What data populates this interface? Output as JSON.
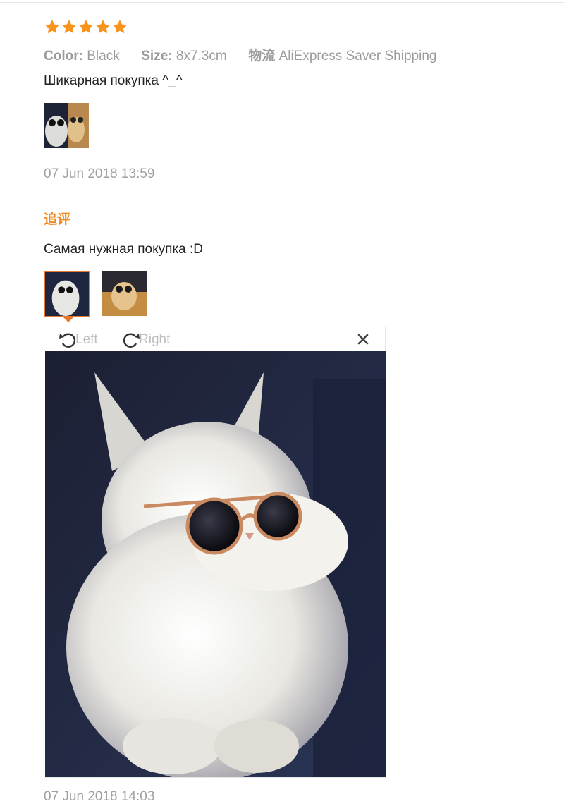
{
  "review1": {
    "stars": 5,
    "star_color": "#f7941d",
    "color_label": "Color:",
    "color_value": "Black",
    "size_label": "Size:",
    "size_value": "8x7.3cm",
    "shipping_label": "物流",
    "shipping_value": "AliExpress Saver Shipping",
    "text": "Шикарная покупка ^_^",
    "date": "07 Jun 2018 13:59"
  },
  "followup": {
    "heading": "追评",
    "heading_color": "#f08a24",
    "text": "Самая нужная покупка :D",
    "selected_thumb_border": "#e8772a",
    "viewer": {
      "rotate_left_label": "Left",
      "rotate_right_label": "Right",
      "rotate_left_icon": "rotate-left-icon",
      "rotate_right_icon": "rotate-right-icon",
      "close_icon": "close-icon"
    },
    "date": "07 Jun 2018 14:03"
  }
}
